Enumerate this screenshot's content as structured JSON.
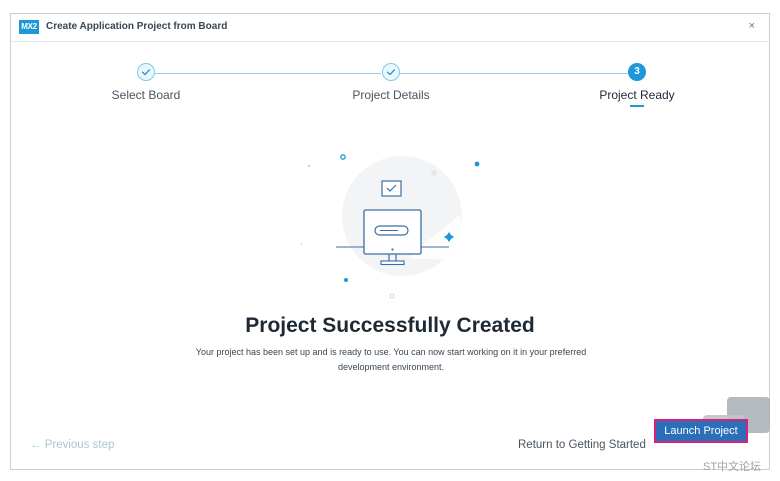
{
  "window": {
    "app_logo": "MX2",
    "title": "Create Application Project from Board",
    "close_glyph": "×"
  },
  "stepper": {
    "steps": [
      {
        "label": "Select Board",
        "state": "done"
      },
      {
        "label": "Project Details",
        "state": "done"
      },
      {
        "label": "Project Ready",
        "state": "current",
        "number": "3"
      }
    ]
  },
  "main": {
    "heading": "Project Successfully Created",
    "description": "Your project has been set up and is ready to use. You can now start working on it in your preferred development environment."
  },
  "footer": {
    "previous_label": "← Previous step",
    "return_label": "Return to Getting Started",
    "launch_label": "Launch Project"
  },
  "watermark": {
    "text": "ST中文论坛"
  },
  "colors": {
    "accent": "#1e98d8",
    "primary_button": "#2a6fb8",
    "highlight_border": "#d6217d"
  }
}
